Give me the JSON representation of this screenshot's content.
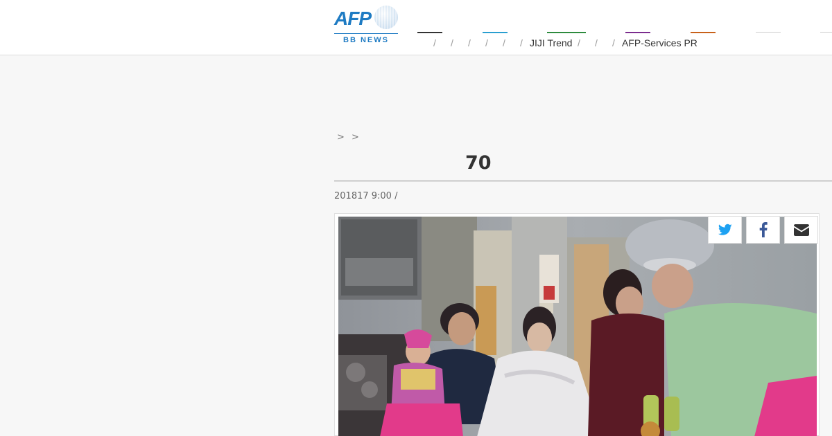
{
  "header": {
    "logo": {
      "brand": "AFP",
      "sub": "BB NEWS"
    },
    "nav": {
      "separator": "/",
      "link_jiji": "JIJI Trend",
      "link_afp_services": "AFP-Services PR"
    },
    "accent_colors": [
      "#333333",
      "#2a9fd0",
      "#2e8b3e",
      "#7b2d8e",
      "#c8611a",
      "#cccccc",
      "#cccccc"
    ]
  },
  "breadcrumb": "> >",
  "article": {
    "title": "　　　　　　　70　　　　　　　　　　　　　　　",
    "meta": "201817 9:00  /"
  },
  "share": {
    "twitter": "twitter-icon",
    "facebook": "facebook-icon",
    "email": "envelope-icon"
  },
  "colors": {
    "brand_blue": "#1e7bc3",
    "background": "#f7f7f7"
  }
}
